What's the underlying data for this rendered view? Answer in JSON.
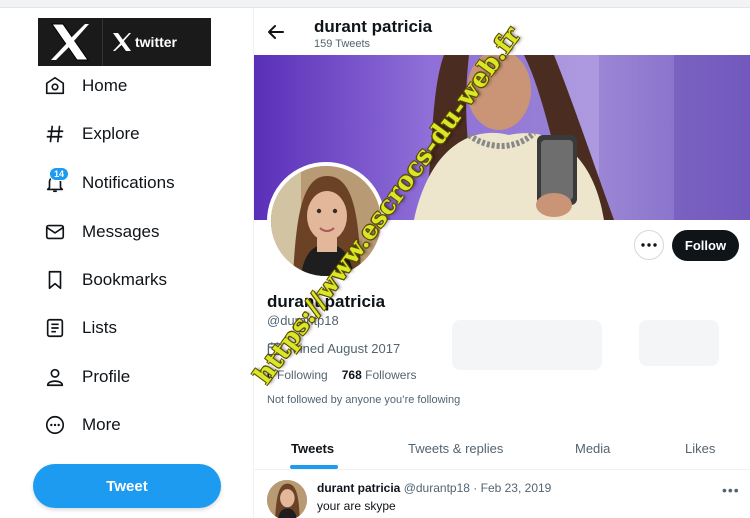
{
  "logo": {
    "wordmark": "twitter"
  },
  "nav": {
    "items": [
      {
        "label": "Home",
        "icon": "home-icon"
      },
      {
        "label": "Explore",
        "icon": "hashtag-icon"
      },
      {
        "label": "Notifications",
        "icon": "bell-icon",
        "badge": "14"
      },
      {
        "label": "Messages",
        "icon": "envelope-icon"
      },
      {
        "label": "Bookmarks",
        "icon": "bookmark-icon"
      },
      {
        "label": "Lists",
        "icon": "list-icon"
      },
      {
        "label": "Profile",
        "icon": "person-icon"
      },
      {
        "label": "More",
        "icon": "more-circle-icon"
      }
    ],
    "tweet_label": "Tweet"
  },
  "header": {
    "name": "durant patricia",
    "tweet_count": "159 Tweets"
  },
  "profile": {
    "name": "durant patricia",
    "handle": "@durantp18",
    "joined": "Joined August 2017",
    "following_count": "0",
    "following_label": "Following",
    "followers_count": "768",
    "followers_label": "Followers",
    "not_followed": "Not followed by anyone you’re following",
    "follow_label": "Follow"
  },
  "tabs": [
    "Tweets",
    "Tweets & replies",
    "Media",
    "Likes"
  ],
  "tweet": {
    "name": "durant patricia",
    "handle": "@durantp18",
    "sep": "·",
    "date": "Feb 23, 2019",
    "text": "your are skype"
  },
  "watermark": "https://www.escrocs-du-web.fr",
  "colors": {
    "accent": "#1d9bf0",
    "text": "#0f1419",
    "muted": "#536471",
    "watermark": "#d8e826"
  }
}
